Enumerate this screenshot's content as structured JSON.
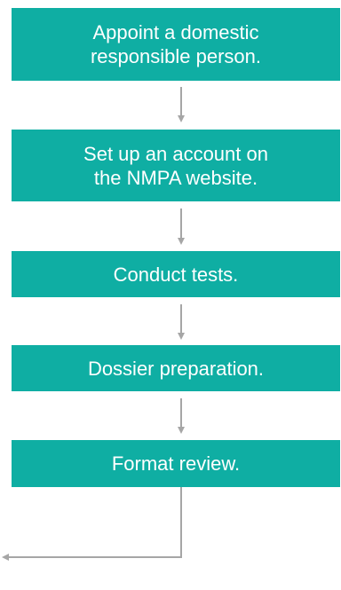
{
  "flow": {
    "steps": [
      {
        "label": "Appoint a domestic\nresponsible person."
      },
      {
        "label": "Set up an account on\nthe NMPA website."
      },
      {
        "label": "Conduct tests."
      },
      {
        "label": "Dossier preparation."
      },
      {
        "label": "Format review."
      }
    ]
  },
  "colors": {
    "step_fill": "#0faea3",
    "step_text": "#ffffff",
    "arrow": "#a6a6a6"
  }
}
